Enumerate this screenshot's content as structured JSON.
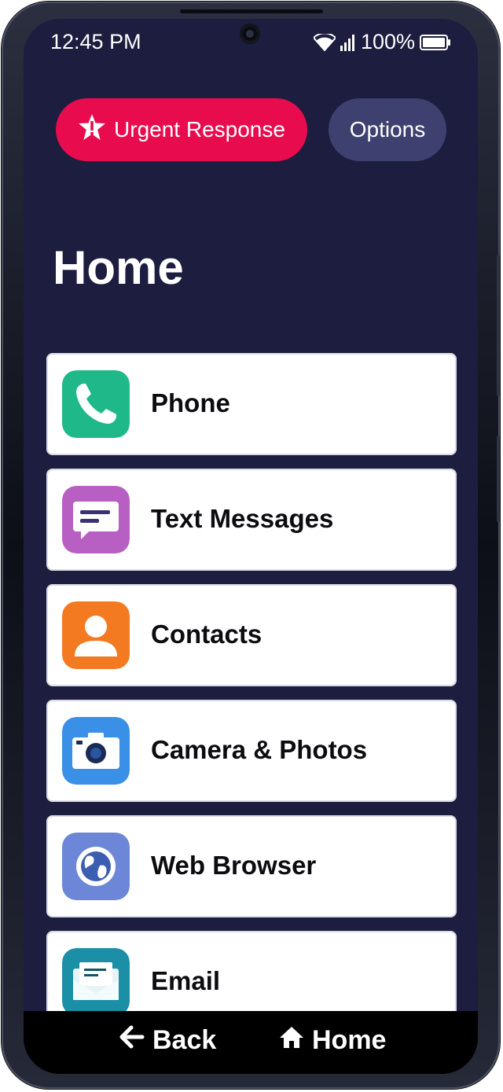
{
  "status_bar": {
    "time": "12:45 PM",
    "battery": "100%",
    "icons": [
      "wifi-icon",
      "signal-icon",
      "battery-icon"
    ]
  },
  "header": {
    "urgent_label": "Urgent Response",
    "urgent_icon": "star-alert-icon",
    "options_label": "Options"
  },
  "page": {
    "title": "Home"
  },
  "apps": [
    {
      "label": "Phone",
      "icon": "phone-icon",
      "color": "#1fb989"
    },
    {
      "label": "Text Messages",
      "icon": "message-icon",
      "color": "#b85fc4"
    },
    {
      "label": "Contacts",
      "icon": "contact-icon",
      "color": "#f47a22"
    },
    {
      "label": "Camera & Photos",
      "icon": "camera-icon",
      "color": "#3a8fe6"
    },
    {
      "label": "Web Browser",
      "icon": "globe-icon",
      "color": "#6c86d8"
    },
    {
      "label": "Email",
      "icon": "email-icon",
      "color": "#1a8fa6"
    }
  ],
  "navbar": {
    "back_label": "Back",
    "home_label": "Home"
  },
  "colors": {
    "screen_bg": "#1c1d3f",
    "urgent": "#e80c4f",
    "options": "#3e4170"
  }
}
